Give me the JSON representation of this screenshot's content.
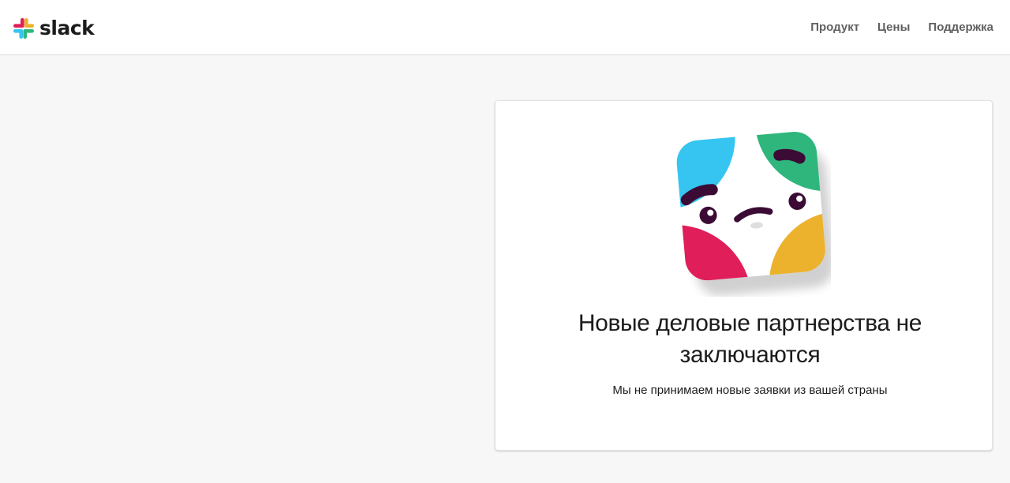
{
  "header": {
    "logo_text": "slack",
    "logo_icon": "slack-hash-logo-icon",
    "nav": [
      {
        "label": "Продукт"
      },
      {
        "label": "Цены"
      },
      {
        "label": "Поддержка"
      }
    ]
  },
  "notice": {
    "illustration": "sad-slack-face-illustration",
    "title": "Новые деловые партнерства не заключаются",
    "message": "Мы не принимаем новые заявки из вашей страны"
  },
  "colors": {
    "blue": "#36c5f0",
    "green": "#2eb67d",
    "red": "#e01e5a",
    "yellow": "#ecb22e",
    "aubergine": "#4a154b",
    "page_bg": "#f7f7f7"
  }
}
